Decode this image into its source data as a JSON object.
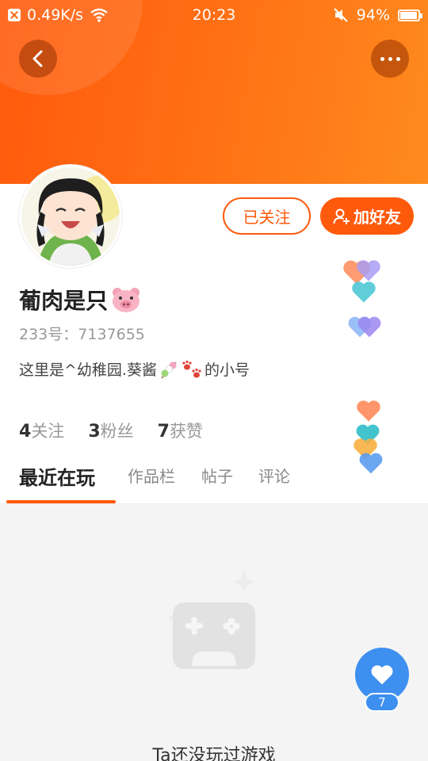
{
  "status_bar": {
    "net_speed": "0.49K/s",
    "time": "20:23",
    "battery": "94%",
    "battery_level": 0.94
  },
  "header": {
    "back_icon": "chevron-left-icon",
    "more_icon": "more-dots-icon"
  },
  "profile": {
    "name": "葡肉是只",
    "name_emoji": "pig-face-icon",
    "uid_text": "233号：7137655",
    "bio_prefix": "这里是^幼稚园.葵酱",
    "bio_suffix": "的小号",
    "follow_label": "已关注",
    "add_friend_label": "加好友"
  },
  "stats": [
    {
      "count": "4",
      "label": "关注"
    },
    {
      "count": "3",
      "label": "粉丝"
    },
    {
      "count": "7",
      "label": "获赞"
    }
  ],
  "tabs": [
    {
      "label": "最近在玩",
      "active": true
    },
    {
      "label": "作品栏",
      "active": false
    },
    {
      "label": "帖子",
      "active": false
    },
    {
      "label": "评论",
      "active": false
    }
  ],
  "empty_state": {
    "icon": "gamepad-icon",
    "text": "Ta还没玩过游戏"
  },
  "like_button": {
    "count": "7",
    "icon": "heart-icon"
  },
  "colors": {
    "accent": "#ff5a0c",
    "like_blue": "#3d8ff0"
  }
}
